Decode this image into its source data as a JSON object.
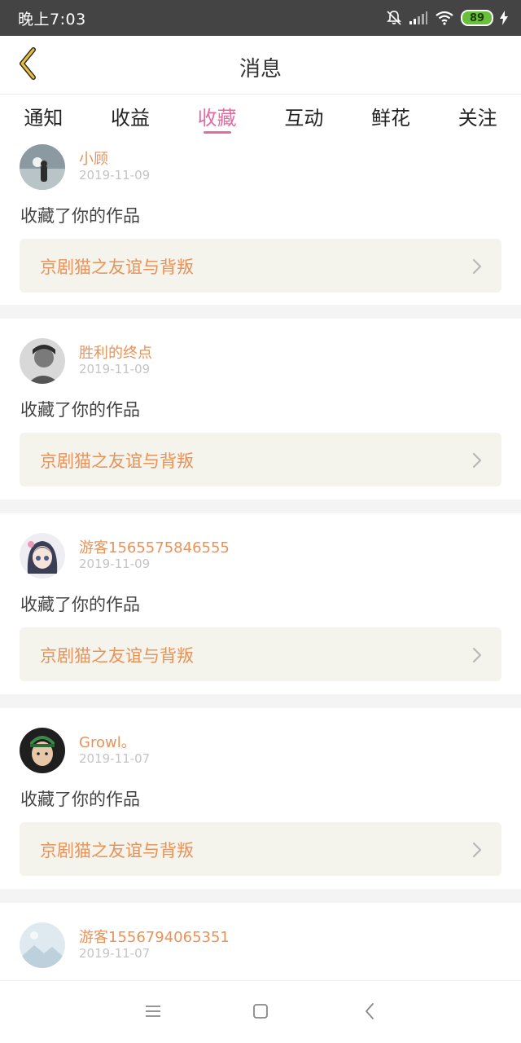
{
  "status_bar": {
    "time": "晚上7:03",
    "battery": "89",
    "icons": [
      "bell-off-icon",
      "signal-icon",
      "wifi-icon",
      "battery-icon",
      "charging-icon"
    ]
  },
  "header": {
    "title": "消息",
    "back_icon": "chevron-left-icon"
  },
  "tabs": [
    {
      "label": "通知",
      "active": false
    },
    {
      "label": "收益",
      "active": false
    },
    {
      "label": "收藏",
      "active": true
    },
    {
      "label": "互动",
      "active": false
    },
    {
      "label": "鲜花",
      "active": false
    },
    {
      "label": "关注",
      "active": false
    }
  ],
  "messages": [
    {
      "user": "小顾",
      "date": "2019-11-09",
      "action": "收藏了你的作品",
      "work": "京剧猫之友谊与背叛"
    },
    {
      "user": "胜利的终点",
      "date": "2019-11-09",
      "action": "收藏了你的作品",
      "work": "京剧猫之友谊与背叛"
    },
    {
      "user": "游客1565575846555",
      "date": "2019-11-09",
      "action": "收藏了你的作品",
      "work": "京剧猫之友谊与背叛"
    },
    {
      "user": "Growl。",
      "date": "2019-11-07",
      "action": "收藏了你的作品",
      "work": "京剧猫之友谊与背叛"
    },
    {
      "user": "游客1556794065351",
      "date": "2019-11-07",
      "action": "",
      "work": ""
    }
  ],
  "nav_bar": {
    "icons": [
      "menu-icon",
      "home-square-icon",
      "back-triangle-icon"
    ]
  },
  "colors": {
    "accent": "#e46aa6",
    "username": "#e8935a",
    "status_bar": "#444444",
    "link_bg": "#f4f3ec"
  }
}
